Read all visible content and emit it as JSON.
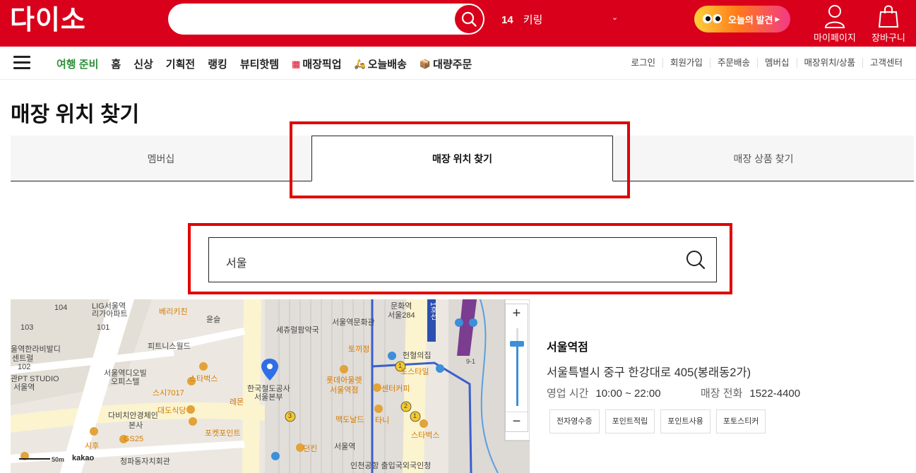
{
  "header": {
    "logo": "다이소",
    "rank_number": "14",
    "rank_keyword": "키링",
    "promo_label": "오늘의 발견",
    "mypage_label": "마이페이지",
    "cart_label": "장바구니"
  },
  "nav": {
    "items": [
      {
        "label": "여행 준비",
        "style": "green"
      },
      {
        "label": "홈"
      },
      {
        "label": "신상"
      },
      {
        "label": "기획전"
      },
      {
        "label": "랭킹"
      },
      {
        "label": "뷰티핫템"
      },
      {
        "label": "매장픽업",
        "icon": "store-icon"
      },
      {
        "label": "오늘배송",
        "icon": "scooter-icon"
      },
      {
        "label": "대량주문",
        "icon": "box-icon"
      }
    ],
    "util": [
      "로그인",
      "회원가입",
      "주문배송",
      "멤버십",
      "매장위치/상품",
      "고객센터"
    ]
  },
  "page": {
    "title": "매장 위치 찾기",
    "tabs": [
      "멤버십",
      "매장 위치 찾기",
      "매장 상품 찾기"
    ],
    "active_tab": 1,
    "search_value": "서울"
  },
  "map": {
    "labels": [
      "LIG서울역",
      "리가아파트",
      "베리키친",
      "윤슬",
      "104",
      "103",
      "101",
      "문화역",
      "서울284",
      "서울역문화관",
      "세츄럴팜약국",
      "피트니스월드",
      "울역한라비발디",
      "센트럴",
      "102",
      "관PT STUDIO",
      "서울역",
      "서울역디오빌",
      "오피스텔",
      "스타벅스",
      "스시7017",
      "헌혈의집",
      "토끼정",
      "롯데아울렛",
      "서울역점",
      "센터커피",
      "도스타일",
      "한국철도공사",
      "서울본부",
      "다비치안경체인",
      "본사",
      "대도식당",
      "레몬",
      "포켓포인트",
      "맥도날드",
      "타니",
      "스타벅스",
      "시후",
      "GS25",
      "던킨",
      "서울역",
      "청파동자치회관",
      "인천공항 출입국외국인청",
      "1호선",
      "9-1",
      "3",
      "1",
      "2",
      "1",
      "50m",
      "kakao"
    ],
    "zoom_in": "+",
    "zoom_out": "−"
  },
  "store": {
    "name": "서울역점",
    "address": "서울특별시 중구 한강대로 405(봉래동2가)",
    "hours_label": "영업 시간",
    "hours_value": "10:00 ~ 22:00",
    "phone_label": "매장 전화",
    "phone_value": "1522-4400",
    "tags": [
      "전자영수증",
      "포인트적립",
      "포인트사용",
      "포토스티커"
    ]
  },
  "colors": {
    "brand_red": "#d8001b",
    "highlight_red": "#e20000",
    "nav_green": "#2f8f3a"
  }
}
